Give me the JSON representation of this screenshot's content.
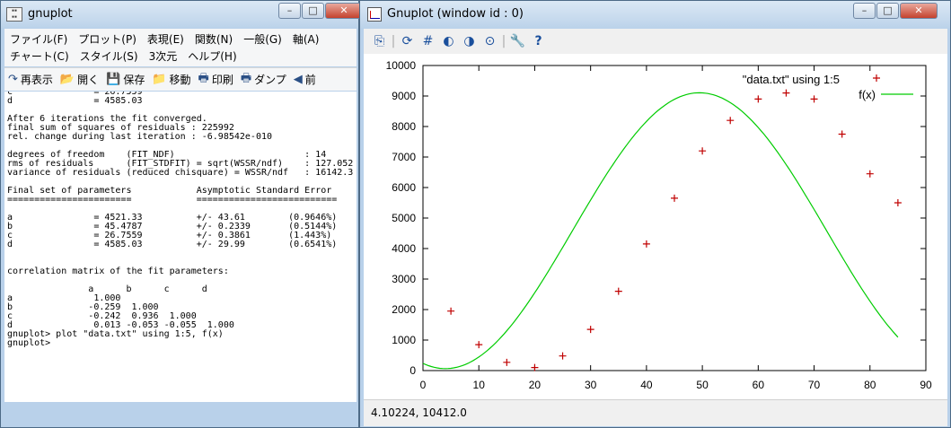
{
  "console": {
    "title": "gnuplot",
    "menu_row1": [
      "ファイル(F)",
      "プロット(P)",
      "表現(E)",
      "関数(N)",
      "一般(G)",
      "軸(A)"
    ],
    "menu_row2": [
      "チャート(C)",
      "スタイル(S)",
      "3次元",
      "ヘルプ(H)"
    ],
    "toolbar": [
      {
        "icon": "refresh-icon",
        "glyph": "↷",
        "label": "再表示"
      },
      {
        "icon": "open-folder-icon",
        "glyph": "📂",
        "label": "開く"
      },
      {
        "icon": "save-icon",
        "glyph": "💾",
        "label": "保存"
      },
      {
        "icon": "move-folder-icon",
        "glyph": "📁",
        "label": "移動"
      },
      {
        "icon": "print-icon",
        "glyph": "🖶",
        "label": "印刷"
      },
      {
        "icon": "dump-print-icon",
        "glyph": "🖶",
        "label": "ダンプ"
      },
      {
        "icon": "back-arrow-icon",
        "glyph": "◀",
        "label": "前"
      }
    ],
    "text": "c               = 26.7559\nd               = 4585.03\n\nAfter 6 iterations the fit converged.\nfinal sum of squares of residuals : 225992\nrel. change during last iteration : -6.98542e-010\n\ndegrees of freedom    (FIT_NDF)                        : 14\nrms of residuals      (FIT_STDFIT) = sqrt(WSSR/ndf)    : 127.052\nvariance of residuals (reduced chisquare) = WSSR/ndf   : 16142.3\n\nFinal set of parameters            Asymptotic Standard Error\n=======================            ==========================\n\na               = 4521.33          +/- 43.61        (0.9646%)\nb               = 45.4787          +/- 0.2339       (0.5144%)\nc               = 26.7559          +/- 0.3861       (1.443%)\nd               = 4585.03          +/- 29.99        (0.6541%)\n\n\ncorrelation matrix of the fit parameters:\n\n               a      b      c      d\na               1.000\nb              -0.259  1.000\nc              -0.242  0.936  1.000\nd               0.013 -0.053 -0.055  1.000\ngnuplot> plot \"data.txt\" using 1:5, f(x)\ngnuplot> "
  },
  "graph_window": {
    "title": "Gnuplot (window id : 0)",
    "toolbar_icons": [
      "copy-clipboard-icon",
      "replot-icon",
      "grid-icon",
      "zoom-previous-icon",
      "zoom-next-icon",
      "unzoom-icon",
      "options-wrench-icon",
      "help-icon"
    ],
    "status": "4.10224,  10412.0"
  },
  "window_buttons": {
    "minimize": "–",
    "maximize": "□",
    "close": "✕"
  },
  "chart_data": {
    "type": "scatter",
    "title": "",
    "xlabel": "",
    "ylabel": "",
    "xlim": [
      0,
      90
    ],
    "ylim": [
      0,
      10000
    ],
    "xticks": [
      0,
      10,
      20,
      30,
      40,
      50,
      60,
      70,
      80,
      90
    ],
    "yticks": [
      0,
      1000,
      2000,
      3000,
      4000,
      5000,
      6000,
      7000,
      8000,
      9000,
      10000
    ],
    "grid": false,
    "legend_placement": "top-right",
    "series": [
      {
        "name": "\"data.txt\" using 1:5",
        "kind": "points",
        "color": "#c00000",
        "x": [
          5,
          10,
          15,
          20,
          25,
          30,
          35,
          40,
          45,
          50,
          55,
          60,
          65,
          70,
          75,
          80,
          85
        ],
        "y": [
          1950,
          850,
          270,
          100,
          480,
          1350,
          2600,
          4150,
          5650,
          7200,
          8200,
          8900,
          9100,
          8900,
          7750,
          6450,
          5500
        ]
      },
      {
        "name": "f(x)",
        "kind": "line",
        "color": "#00cc00",
        "function": {
          "a": 4521.33,
          "b": 45.4787,
          "c": 26.7559,
          "d": 4585.03
        },
        "x_range": [
          0,
          85
        ]
      }
    ]
  }
}
